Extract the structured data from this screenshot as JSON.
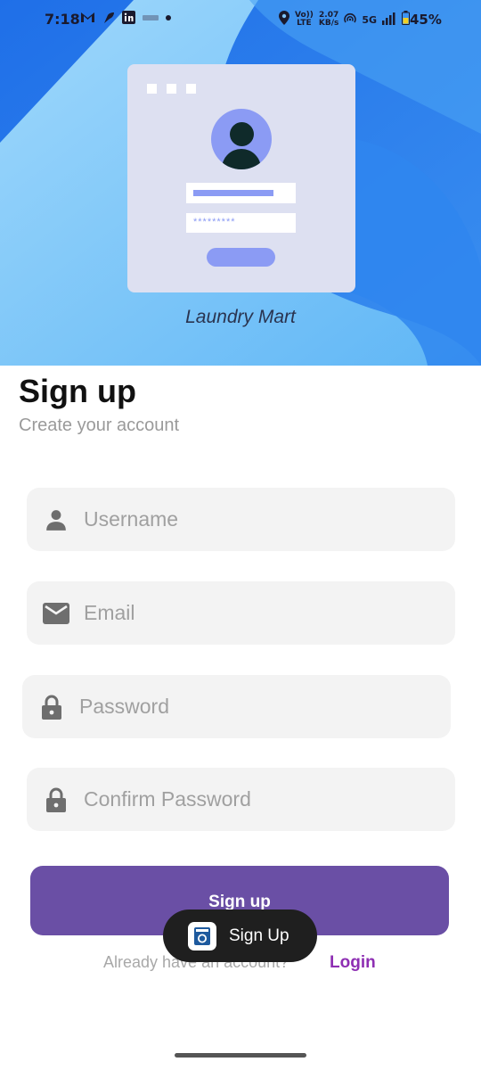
{
  "status_bar": {
    "time": "7:18",
    "network_speed_value": "2.07",
    "network_speed_unit": "KB/s",
    "volte": "Vo))",
    "lte": "LTE",
    "network_type": "5G",
    "battery": "45%"
  },
  "hero": {
    "app_name": "Laundry Mart",
    "password_mask": "*********"
  },
  "page": {
    "title": "Sign up",
    "subtitle": "Create your account"
  },
  "form": {
    "username_placeholder": "Username",
    "email_placeholder": "Email",
    "password_placeholder": "Password",
    "confirm_password_placeholder": "Confirm Password",
    "submit_label": "Sign up"
  },
  "footer": {
    "prompt": "Already have an account?",
    "login_label": "Login"
  },
  "toast": {
    "text": "Sign Up"
  },
  "colors": {
    "primary_button": "#6a4fa5",
    "link": "#8e2fb3",
    "hero_blue": "#2f7fe8",
    "field_bg": "#f3f3f3"
  },
  "icons": [
    "user-icon",
    "mail-icon",
    "lock-icon",
    "washing-machine-icon",
    "location-icon",
    "signal-icon",
    "battery-icon",
    "gmail-icon",
    "linkedin-icon"
  ]
}
